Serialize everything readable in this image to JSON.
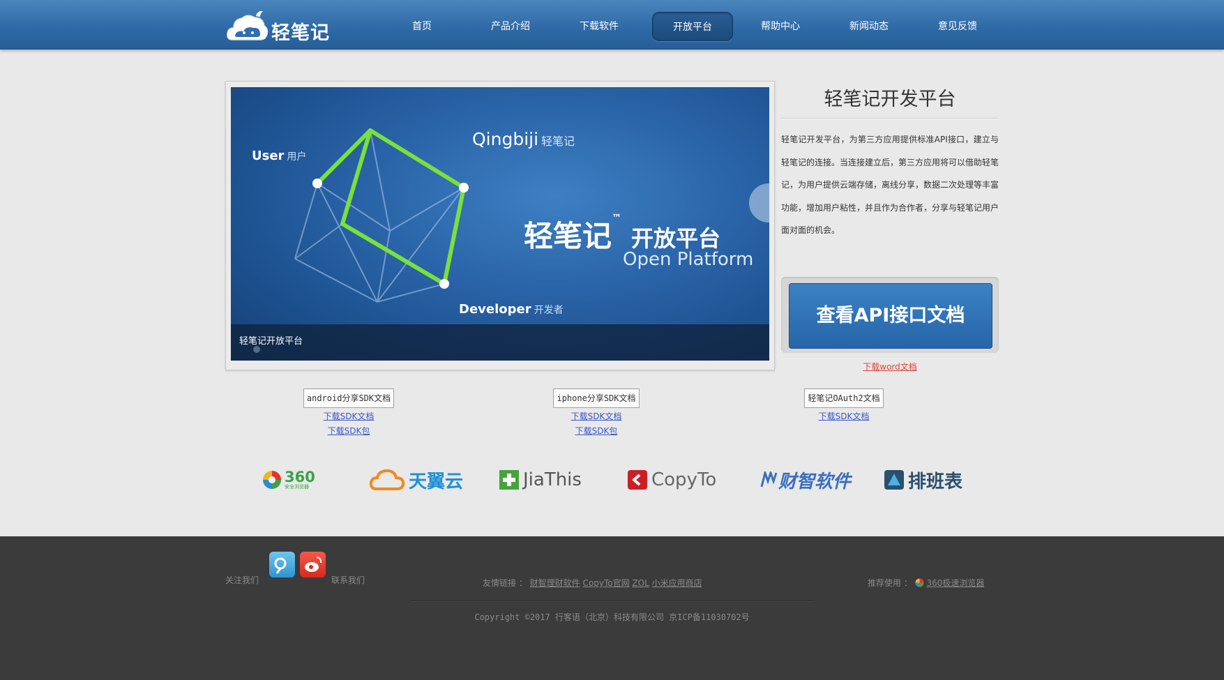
{
  "header": {
    "logo_text": "轻笔记",
    "nav": [
      {
        "label": "首页",
        "active": false
      },
      {
        "label": "产品介绍",
        "active": false
      },
      {
        "label": "下载软件",
        "active": false
      },
      {
        "label": "开放平台",
        "active": true
      },
      {
        "label": "帮助中心",
        "active": false
      },
      {
        "label": "新闻动态",
        "active": false
      },
      {
        "label": "意见反馈",
        "active": false
      }
    ]
  },
  "banner": {
    "user": "User",
    "user_cn": "用户",
    "qingbiji": "Qingbiji",
    "qingbiji_cn": "轻笔记",
    "title": "轻笔记",
    "tm": "™",
    "title_suffix": "开放平台",
    "subtitle": "Open Platform",
    "developer": "Developer",
    "developer_cn": "开发者",
    "caption": "轻笔记开放平台"
  },
  "side": {
    "title": "轻笔记开发平台",
    "description": "轻笔记开发平台，为第三方应用提供标准API接口，建立与轻笔记的连接。当连接建立后，第三方应用将可以借助轻笔记，为用户提供云端存储，离线分享，数据二次处理等丰富功能，增加用户粘性，并且作为合作者，分享与轻笔记用户面对面的机会。",
    "api_button": "查看API接口文档",
    "word_link": "下载word文档"
  },
  "sdk": [
    {
      "label": "android分享SDK文档",
      "links": [
        "下载SDK文档",
        "下载SDK包"
      ]
    },
    {
      "label": "iphone分享SDK文档",
      "links": [
        "下载SDK文档",
        "下载SDK包"
      ]
    },
    {
      "label": "轻笔记OAuth2文档",
      "links": [
        "下载SDK文档"
      ]
    }
  ],
  "partners": [
    {
      "name": "360",
      "sub": "安全浏览器",
      "icon": "360-browser-icon"
    },
    {
      "name": "天翼云",
      "icon": "cloud-icon"
    },
    {
      "name": "JiaThis",
      "icon": "plus-icon"
    },
    {
      "name": "CopyTo",
      "icon": "copyto-icon"
    },
    {
      "name": "财智软件",
      "icon": "caizhi-icon"
    },
    {
      "name": "排班表",
      "icon": "schedule-icon"
    }
  ],
  "footer": {
    "follow_label": "关注我们",
    "contact": "联系我们",
    "friend_label": "友情链接 ：",
    "friend_links": [
      "财智理财软件",
      "CopyTo官网",
      "ZOL",
      "小米应用商店"
    ],
    "recommend_label": "推荐使用 ：",
    "recommend_link": "360极速浏览器",
    "copyright": "Copyright ©2017 行客语（北京）科技有限公司 京ICP备11030702号"
  },
  "colors": {
    "header_blue": "#2e69a5",
    "accent_green": "#7be03a",
    "api_button_blue": "#2f72b8",
    "link_blue": "#3956c8",
    "link_red": "#e0433a",
    "footer_bg": "#3b3b3b"
  }
}
